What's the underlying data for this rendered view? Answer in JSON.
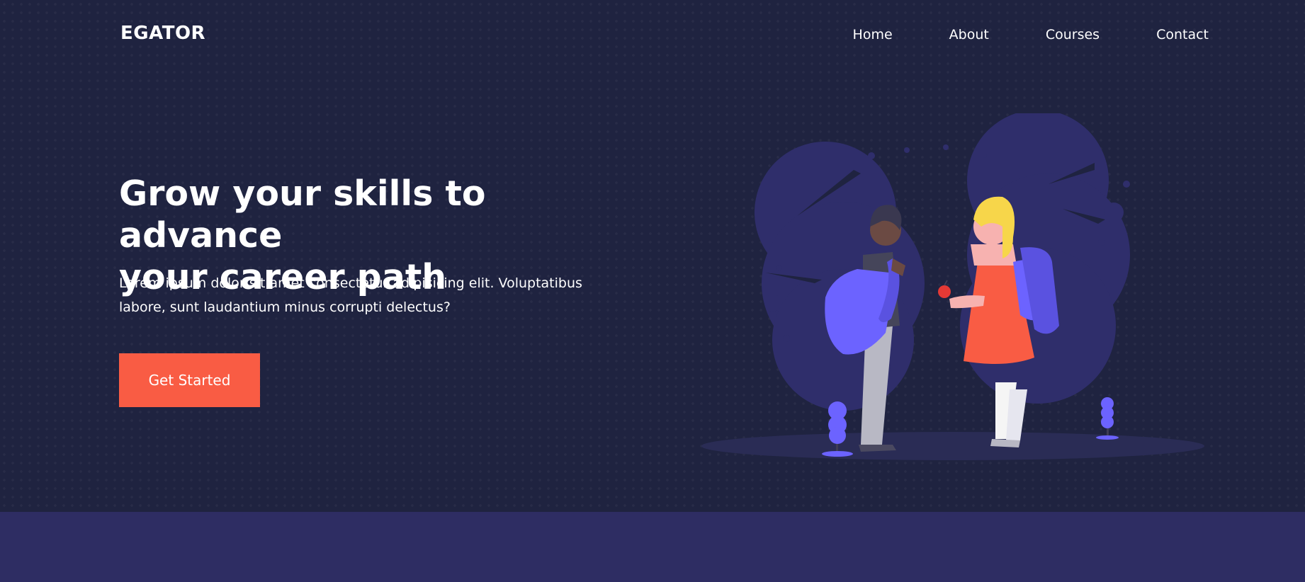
{
  "header": {
    "logo": "EGATOR",
    "nav": [
      "Home",
      "About",
      "Courses",
      "Contact"
    ]
  },
  "hero": {
    "headline_line1": "Grow your skills to advance",
    "headline_line2": "your career path",
    "lede_line1": "Lorem ipsum dolor sit amet consectetur adipisicing elit. Voluptatibus",
    "lede_line2": "labore, sunt laudantium minus corrupti delectus?",
    "cta_label": "Get Started"
  },
  "colors": {
    "background": "#1f2340",
    "accent": "#f95c44",
    "band": "#2e2d63",
    "illustration_purple": "#6c63ff",
    "blob": "#2f2e6b"
  },
  "illustration": {
    "subject": "two students with backpacks",
    "icons": [
      "boy-figure",
      "girl-figure",
      "backpack-icon",
      "apple-icon",
      "tree-icon"
    ]
  }
}
